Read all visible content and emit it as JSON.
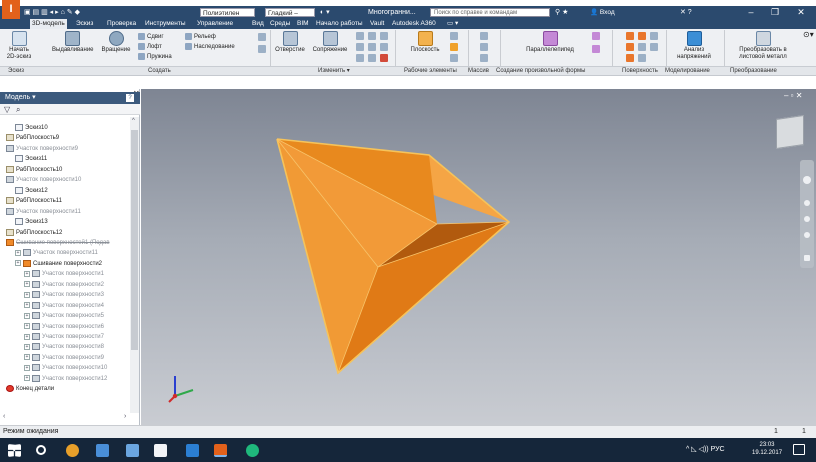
{
  "titlebar": {
    "logo": "I",
    "material_combo": "Полиэтилен",
    "appearance_combo": "Гладкий –",
    "doc_title": "Многогранни...",
    "help_search_placeholder": "Поиск по справке и командам",
    "login": "Вход",
    "minimize": "–",
    "maximize": "❐",
    "close": "✕"
  },
  "tabs": [
    {
      "label": "3D-модель",
      "active": true
    },
    {
      "label": "Эскиз"
    },
    {
      "label": "Проверка"
    },
    {
      "label": "Инструменты"
    },
    {
      "label": "Управление"
    },
    {
      "label": "Вид"
    },
    {
      "label": "Среды"
    },
    {
      "label": "BIM"
    },
    {
      "label": "Начало работы"
    },
    {
      "label": "Vault"
    },
    {
      "label": "Autodesk A360"
    }
  ],
  "ribbon": {
    "start_sketch": "Начать\n2D-эскиз",
    "extrude": "Выдавливание",
    "revolve": "Вращение",
    "sweep": "Сдвиг",
    "loft": "Лофт",
    "coil": "Пружина",
    "emboss": "Рельеф",
    "derive": "Наследование",
    "hole": "Отверстие",
    "fillet": "Сопряжение",
    "plane": "Плоскость",
    "box": "Параллелепипед",
    "stress": "Анализ\nнапряжений",
    "convert": "Преобразовать в\nлистовой металл"
  },
  "panels": {
    "sketch": "Эскиз",
    "create": "Создать",
    "modify": "Изменить ▾",
    "work": "Рабочие элементы",
    "mass": "Массив",
    "freeform": "Создание произвольной формы",
    "surface": "Поверхность",
    "simulation": "Моделирование",
    "convert": "Преобразование"
  },
  "browser": {
    "title": "Модель ▾",
    "help": "?",
    "items": [
      {
        "label": "Эскиз10",
        "indent": 1,
        "type": "sk"
      },
      {
        "label": "РабПлоскость9",
        "indent": 0,
        "type": "pl2"
      },
      {
        "label": "Участок поверхности9",
        "indent": 0,
        "type": "surf",
        "dim": true
      },
      {
        "label": "Эскиз11",
        "indent": 1,
        "type": "sk"
      },
      {
        "label": "РабПлоскость10",
        "indent": 0,
        "type": "pl2"
      },
      {
        "label": "Участок поверхности10",
        "indent": 0,
        "type": "surf",
        "dim": true
      },
      {
        "label": "Эскиз12",
        "indent": 1,
        "type": "sk"
      },
      {
        "label": "РабПлоскость11",
        "indent": 0,
        "type": "pl2"
      },
      {
        "label": "Участок поверхности11",
        "indent": 0,
        "type": "surf",
        "dim": true
      },
      {
        "label": "Эскиз13",
        "indent": 1,
        "type": "sk"
      },
      {
        "label": "РабПлоскость12",
        "indent": 0,
        "type": "pl2"
      },
      {
        "label": "Сшивание поверхностей1 (Подав",
        "indent": 0,
        "type": "knit",
        "strike": true
      },
      {
        "label": "Участок поверхности11",
        "indent": 1,
        "type": "surf",
        "dim": true
      },
      {
        "label": "Сшивание поверхности2",
        "indent": 1,
        "type": "knit"
      },
      {
        "label": "Участок поверхности1",
        "indent": 2,
        "type": "surf",
        "dim": true
      },
      {
        "label": "Участок поверхности2",
        "indent": 2,
        "type": "surf",
        "dim": true
      },
      {
        "label": "Участок поверхности3",
        "indent": 2,
        "type": "surf",
        "dim": true
      },
      {
        "label": "Участок поверхности4",
        "indent": 2,
        "type": "surf",
        "dim": true
      },
      {
        "label": "Участок поверхности5",
        "indent": 2,
        "type": "surf",
        "dim": true
      },
      {
        "label": "Участок поверхности6",
        "indent": 2,
        "type": "surf",
        "dim": true
      },
      {
        "label": "Участок поверхности7",
        "indent": 2,
        "type": "surf",
        "dim": true
      },
      {
        "label": "Участок поверхности8",
        "indent": 2,
        "type": "surf",
        "dim": true
      },
      {
        "label": "Участок поверхности9",
        "indent": 2,
        "type": "surf",
        "dim": true
      },
      {
        "label": "Участок поверхности10",
        "indent": 2,
        "type": "surf",
        "dim": true
      },
      {
        "label": "Участок поверхности12",
        "indent": 2,
        "type": "surf",
        "dim": true
      },
      {
        "label": "Конец детали",
        "indent": 0,
        "type": "end"
      }
    ]
  },
  "status": {
    "text": "Режим ожидания",
    "num1": "1",
    "num2": "1"
  },
  "taskbar": {
    "lang": "РУС",
    "time": "23:03",
    "date": "19.12.2017"
  },
  "colors": {
    "accent": "#2b4a6e",
    "shape_light": "#f5a23c",
    "shape_mid": "#e88620",
    "shape_dark": "#b2570c"
  }
}
